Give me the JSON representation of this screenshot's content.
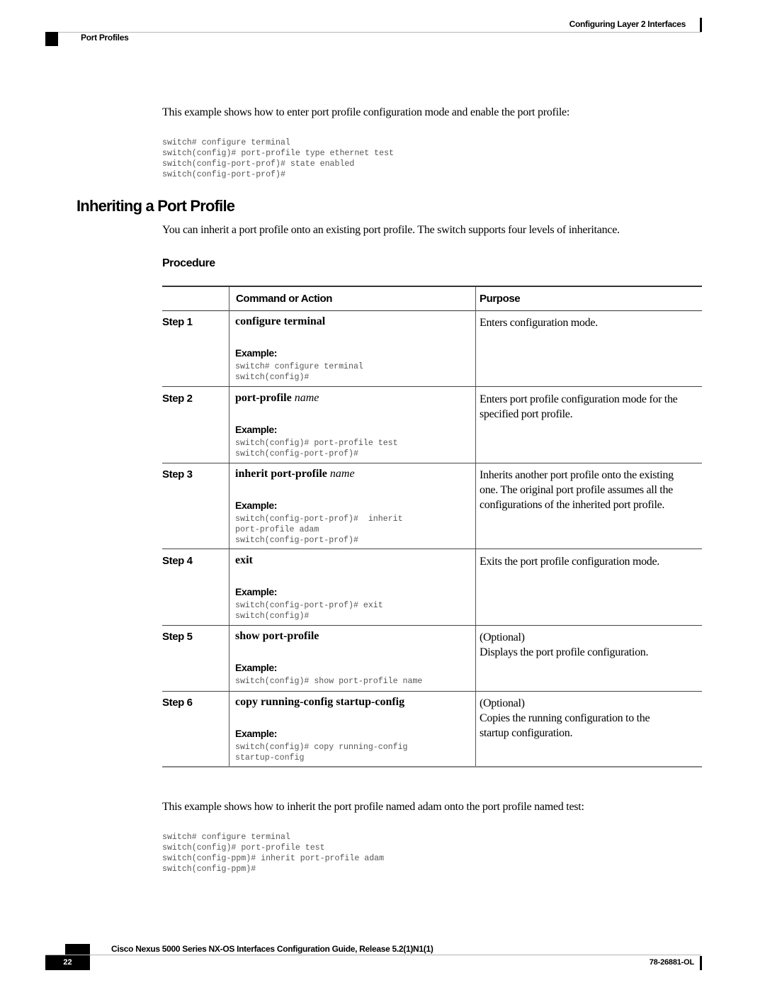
{
  "header": {
    "chapter": "Configuring Layer 2 Interfaces",
    "section": "Port Profiles"
  },
  "intro": {
    "text": "This example shows how to enter port profile configuration mode and enable the port profile:",
    "code": [
      "switch# configure terminal",
      "switch(config)# port-profile type ethernet test",
      "switch(config-port-prof)# state enabled",
      "switch(config-port-prof)#"
    ]
  },
  "section": {
    "title": "Inheriting a Port Profile",
    "description": "You can inherit a port profile onto an existing port profile. The switch supports four levels of inheritance.",
    "procedure_heading": "Procedure"
  },
  "table": {
    "columns": [
      "",
      "Command or Action",
      "Purpose"
    ],
    "example_label": "Example:",
    "steps": [
      {
        "step": "Step 1",
        "command_bold": "configure terminal",
        "command_italic": "",
        "example": [
          "switch# configure terminal",
          "switch(config)#"
        ],
        "purpose": [
          "Enters configuration mode."
        ]
      },
      {
        "step": "Step 2",
        "command_bold": "port-profile",
        "command_italic": "name",
        "example": [
          "switch(config)# port-profile test",
          "switch(config-port-prof)#"
        ],
        "purpose": [
          "Enters port profile configuration mode for the",
          "specified port profile."
        ]
      },
      {
        "step": "Step 3",
        "command_bold": "inherit port-profile",
        "command_italic": "name",
        "example": [
          "switch(config-port-prof)#  inherit",
          "port-profile adam",
          "switch(config-port-prof)#"
        ],
        "purpose": [
          "Inherits another port profile onto the existing",
          "one. The original port profile assumes all the",
          "configurations of the inherited port profile."
        ]
      },
      {
        "step": "Step 4",
        "command_bold": "exit",
        "command_italic": "",
        "example": [
          "switch(config-port-prof)# exit",
          "switch(config)#"
        ],
        "purpose": [
          "Exits the port profile configuration mode."
        ]
      },
      {
        "step": "Step 5",
        "command_bold": "show port-profile",
        "command_italic": "",
        "example": [
          "switch(config)# show port-profile name"
        ],
        "purpose": [
          "(Optional)",
          "Displays the port profile configuration."
        ]
      },
      {
        "step": "Step 6",
        "command_bold": "copy running-config startup-config",
        "command_italic": "",
        "example": [
          "switch(config)# copy running-config",
          "startup-config"
        ],
        "purpose": [
          "(Optional)",
          "Copies the running configuration to the",
          "startup configuration."
        ]
      }
    ]
  },
  "outro": {
    "text": "This example shows how to inherit the port profile named adam onto the port profile named test:",
    "code": [
      "switch# configure terminal",
      "switch(config)# port-profile test",
      "switch(config-ppm)# inherit port-profile adam",
      "switch(config-ppm)#"
    ]
  },
  "footer": {
    "book_title": "Cisco Nexus 5000 Series NX-OS Interfaces Configuration Guide, Release 5.2(1)N1(1)",
    "page_number": "22",
    "doc_number": "78-26881-OL"
  }
}
